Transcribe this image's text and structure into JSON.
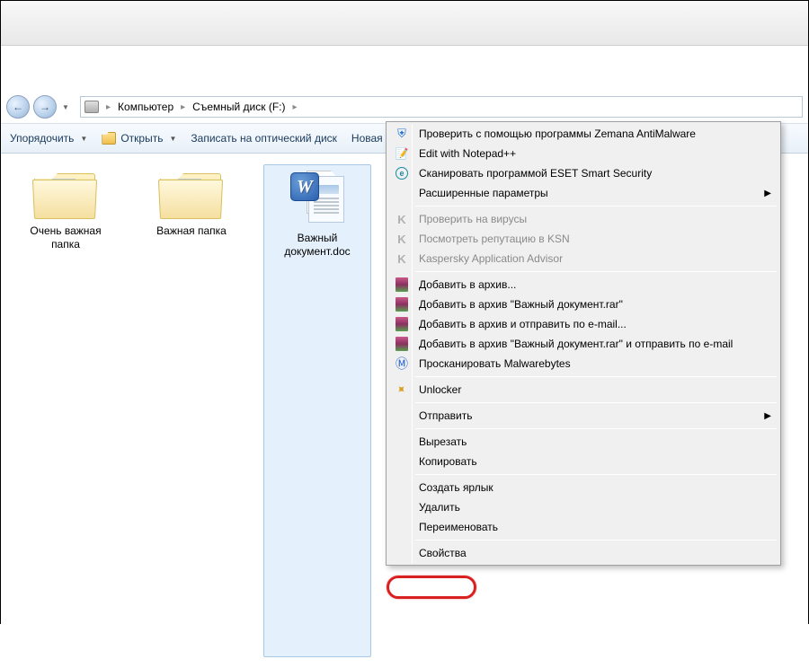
{
  "titlebar": {},
  "nav": {
    "back": "←",
    "forward": "→"
  },
  "breadcrumb": {
    "items": [
      "Компьютер",
      "Съемный диск (F:)"
    ]
  },
  "toolbar": {
    "organize": "Упорядочить",
    "open": "Открыть",
    "burn": "Записать на оптический диск",
    "newfolder": "Новая папка"
  },
  "files": [
    {
      "label": "Очень важная папка",
      "type": "folder"
    },
    {
      "label": "Важная папка",
      "type": "folder"
    },
    {
      "label": "Важный документ.doc",
      "type": "doc"
    }
  ],
  "contextmenu": {
    "zemana": "Проверить с помощью программы Zemana AntiMalware",
    "notepadpp": "Edit with Notepad++",
    "eset": "Сканировать программой ESET Smart Security",
    "extended": "Расширенные параметры",
    "kcheck": "Проверить на вирусы",
    "kreputation": "Посмотреть репутацию в KSN",
    "kadvisor": "Kaspersky Application Advisor",
    "rar_add": "Добавить в архив...",
    "rar_addname": "Добавить в архив \"Важный документ.rar\"",
    "rar_email": "Добавить в архив и отправить по e-mail...",
    "rar_nameemail": "Добавить в архив \"Важный документ.rar\" и отправить по e-mail",
    "malwarebytes": "Просканировать Malwarebytes",
    "unlocker": "Unlocker",
    "sendto": "Отправить",
    "cut": "Вырезать",
    "copy": "Копировать",
    "shortcut": "Создать ярлык",
    "delete": "Удалить",
    "rename": "Переименовать",
    "properties": "Свойства"
  }
}
